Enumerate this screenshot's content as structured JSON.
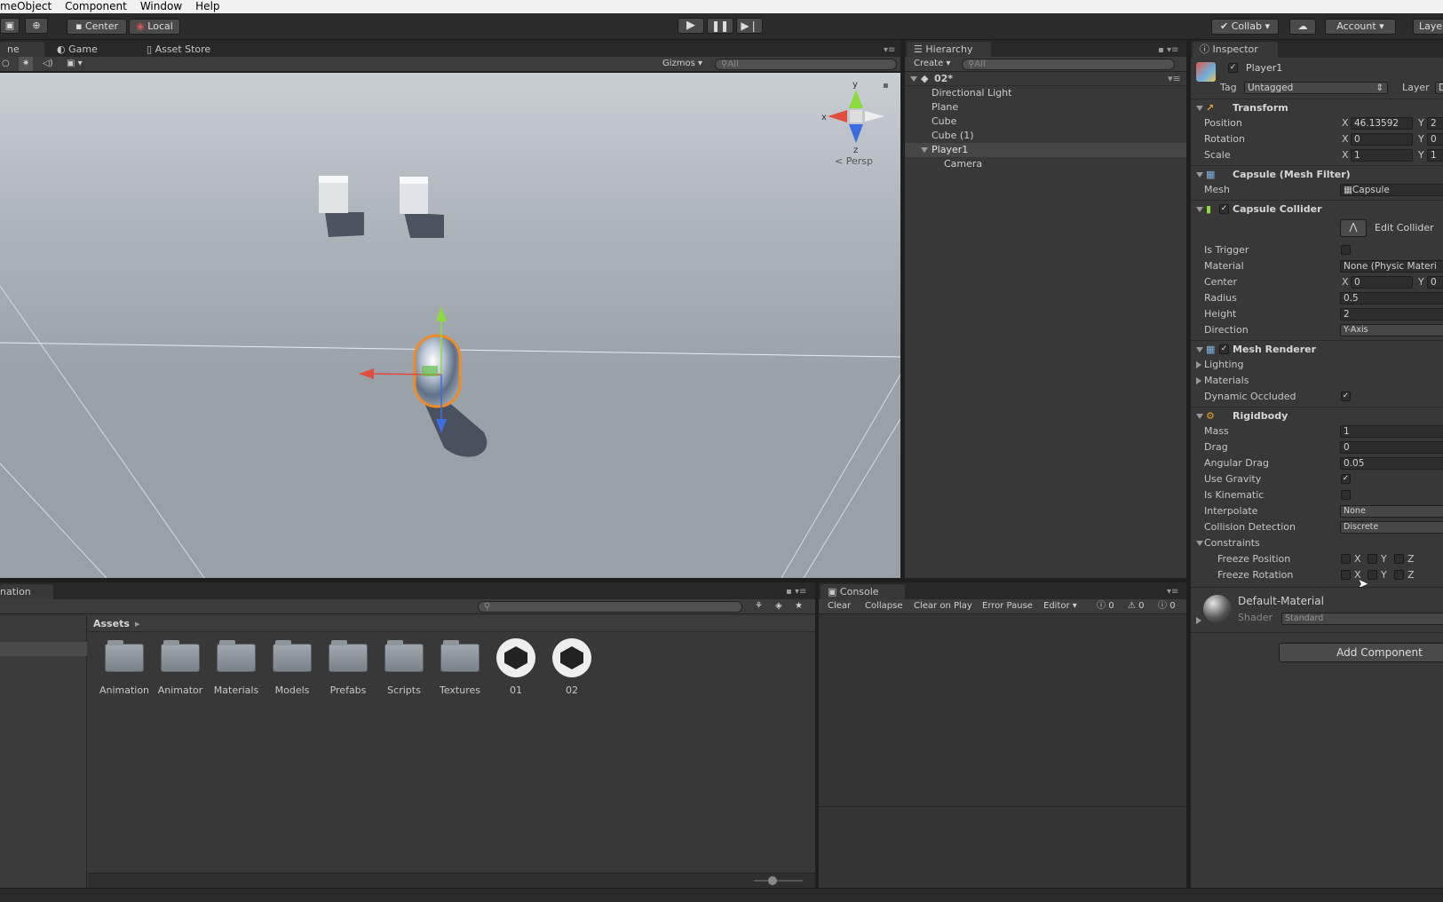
{
  "menu": [
    "meObject",
    "Component",
    "Window",
    "Help"
  ],
  "toolbar": {
    "pivot": "Center",
    "space": "Local",
    "collab": "Collab",
    "account": "Account",
    "layers": "Laye"
  },
  "scene": {
    "tabs": [
      "ne",
      "Game",
      "Asset Store"
    ],
    "gizmos": "Gizmos",
    "search_placeholder": "All",
    "persp": "Persp",
    "axis_y": "y",
    "axis_x": "x",
    "axis_z": "z"
  },
  "hierarchy": {
    "tab": "Hierarchy",
    "create": "Create",
    "search_placeholder": "All",
    "scene_name": "02*",
    "items": [
      "Directional Light",
      "Plane",
      "Cube",
      "Cube (1)",
      "Player1",
      "Camera"
    ]
  },
  "inspector": {
    "tab": "Inspector",
    "object_name": "Player1",
    "tag_label": "Tag",
    "tag_value": "Untagged",
    "layer_label": "Layer",
    "layer_value": "D",
    "transform": {
      "title": "Transform",
      "position_label": "Position",
      "position_x": "46.13592",
      "position_y": "2",
      "rotation_label": "Rotation",
      "rotation_x": "0",
      "rotation_y": "0",
      "scale_label": "Scale",
      "scale_x": "1",
      "scale_y": "1"
    },
    "mesh_filter": {
      "title": "Capsule (Mesh Filter)",
      "mesh_label": "Mesh",
      "mesh_value": "Capsule"
    },
    "capsule_collider": {
      "title": "Capsule Collider",
      "edit_collider": "Edit Collider",
      "is_trigger": "Is Trigger",
      "material": "Material",
      "material_value": "None (Physic Materi",
      "center": "Center",
      "center_x": "0",
      "center_y": "0",
      "radius": "Radius",
      "radius_value": "0.5",
      "height": "Height",
      "height_value": "2",
      "direction": "Direction",
      "direction_value": "Y-Axis"
    },
    "mesh_renderer": {
      "title": "Mesh Renderer",
      "lighting": "Lighting",
      "materials": "Materials",
      "dynamic_occluded": "Dynamic Occluded"
    },
    "rigidbody": {
      "title": "Rigidbody",
      "mass": "Mass",
      "mass_value": "1",
      "drag": "Drag",
      "drag_value": "0",
      "angular_drag": "Angular Drag",
      "angular_drag_value": "0.05",
      "use_gravity": "Use Gravity",
      "is_kinematic": "Is Kinematic",
      "interpolate": "Interpolate",
      "interpolate_value": "None",
      "collision_detection": "Collision Detection",
      "collision_value": "Discrete",
      "constraints": "Constraints",
      "freeze_position": "Freeze Position",
      "freeze_rotation": "Freeze Rotation"
    },
    "axis_letters": {
      "x": "X",
      "y": "Y",
      "z": "Z"
    },
    "material": {
      "name": "Default-Material",
      "shader_label": "Shader",
      "shader_value": "Standard"
    },
    "add_component": "Add Component"
  },
  "bottom_left": {
    "tab": "nation"
  },
  "project": {
    "assets_label": "Assets",
    "items": [
      {
        "name": "Animation",
        "type": "folder"
      },
      {
        "name": "Animator",
        "type": "folder"
      },
      {
        "name": "Materials",
        "type": "folder"
      },
      {
        "name": "Models",
        "type": "folder"
      },
      {
        "name": "Prefabs",
        "type": "folder"
      },
      {
        "name": "Scripts",
        "type": "folder"
      },
      {
        "name": "Textures",
        "type": "folder"
      },
      {
        "name": "01",
        "type": "scene"
      },
      {
        "name": "02",
        "type": "scene"
      }
    ]
  },
  "console": {
    "tab": "Console",
    "buttons": [
      "Clear",
      "Collapse",
      "Clear on Play",
      "Error Pause",
      "Editor"
    ],
    "error_count": "0",
    "warning_count": "0",
    "message_count": "0"
  }
}
